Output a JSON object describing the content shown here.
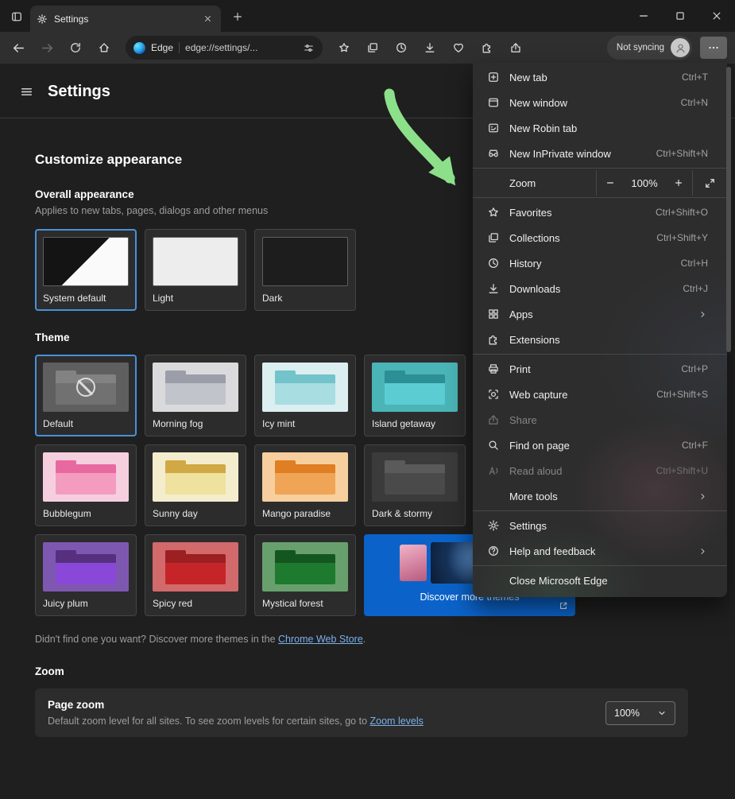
{
  "colors": {
    "accent_blue": "#4a90d9",
    "link_blue": "#7ab0ea",
    "discover_blue": "#0b63c9",
    "annotation_green": "#8de08a"
  },
  "titlebar": {
    "tab_title": "Settings"
  },
  "toolbar": {
    "site_badge": "Edge",
    "url": "edge://settings/...",
    "profile_label": "Not syncing"
  },
  "page": {
    "header_title": "Settings",
    "section_title": "Customize appearance",
    "overall": {
      "title": "Overall appearance",
      "subtitle": "Applies to new tabs, pages, dialogs and other menus",
      "cards": [
        {
          "label": "System default",
          "selected": true
        },
        {
          "label": "Light",
          "selected": false
        },
        {
          "label": "Dark",
          "selected": false
        }
      ]
    },
    "themes": {
      "title": "Theme",
      "cards": [
        {
          "label": "Default",
          "selected": true,
          "bg": "#5f5f5f",
          "band": "#828282",
          "body": "#717171"
        },
        {
          "label": "Morning fog",
          "selected": false,
          "bg": "#dadadd",
          "band": "#9b9ea8",
          "body": "#c2c4cb"
        },
        {
          "label": "Icy mint",
          "selected": false,
          "bg": "#dbeef0",
          "band": "#72c3ca",
          "body": "#a8dde2"
        },
        {
          "label": "Island getaway",
          "selected": false,
          "bg": "#4ab4b7",
          "band": "#2b8f95",
          "body": "#5bcdd2"
        },
        {
          "label": "Bubblegum",
          "selected": false,
          "bg": "#f6cfdf",
          "band": "#e8699f",
          "body": "#f49cc0"
        },
        {
          "label": "Sunny day",
          "selected": false,
          "bg": "#f4edcd",
          "band": "#d0a844",
          "body": "#efe19e"
        },
        {
          "label": "Mango paradise",
          "selected": false,
          "bg": "#f7cf9e",
          "band": "#df7e22",
          "body": "#f0a455"
        },
        {
          "label": "Dark & stormy",
          "selected": false,
          "bg": "#3b3b3b",
          "band": "#5a5a5a",
          "body": "#4a4a4a"
        },
        {
          "label": "Juicy plum",
          "selected": false,
          "bg": "#7e58b0",
          "band": "#56307f",
          "body": "#8a48d8"
        },
        {
          "label": "Spicy red",
          "selected": false,
          "bg": "#d2696b",
          "band": "#9c1f22",
          "body": "#c52528"
        },
        {
          "label": "Mystical forest",
          "selected": false,
          "bg": "#68a06d",
          "band": "#14561f",
          "body": "#1e7a2e"
        }
      ],
      "discover_label": "Discover more themes"
    },
    "store_note": {
      "prefix": "Didn't find one you want? Discover more themes in the ",
      "link": "Chrome Web Store",
      "suffix": "."
    },
    "zoom": {
      "title": "Zoom",
      "card_title": "Page zoom",
      "desc_prefix": "Default zoom level for all sites. To see zoom levels for certain sites, go to ",
      "desc_link": "Zoom levels",
      "value": "100%"
    }
  },
  "menu": {
    "zoom": {
      "label": "Zoom",
      "value": "100%"
    },
    "items": [
      {
        "label": "New tab",
        "shortcut": "Ctrl+T"
      },
      {
        "label": "New window",
        "shortcut": "Ctrl+N"
      },
      {
        "label": "New Robin tab",
        "shortcut": ""
      },
      {
        "label": "New InPrivate window",
        "shortcut": "Ctrl+Shift+N"
      },
      {
        "label": "Favorites",
        "shortcut": "Ctrl+Shift+O"
      },
      {
        "label": "Collections",
        "shortcut": "Ctrl+Shift+Y"
      },
      {
        "label": "History",
        "shortcut": "Ctrl+H"
      },
      {
        "label": "Downloads",
        "shortcut": "Ctrl+J"
      },
      {
        "label": "Apps",
        "shortcut": "",
        "submenu": true
      },
      {
        "label": "Extensions",
        "shortcut": ""
      },
      {
        "label": "Print",
        "shortcut": "Ctrl+P"
      },
      {
        "label": "Web capture",
        "shortcut": "Ctrl+Shift+S"
      },
      {
        "label": "Share",
        "shortcut": "",
        "disabled": true
      },
      {
        "label": "Find on page",
        "shortcut": "Ctrl+F"
      },
      {
        "label": "Read aloud",
        "shortcut": "Ctrl+Shift+U",
        "disabled": true
      },
      {
        "label": "More tools",
        "shortcut": "",
        "submenu": true
      },
      {
        "label": "Settings",
        "shortcut": ""
      },
      {
        "label": "Help and feedback",
        "shortcut": "",
        "submenu": true
      },
      {
        "label": "Close Microsoft Edge",
        "shortcut": ""
      }
    ]
  }
}
